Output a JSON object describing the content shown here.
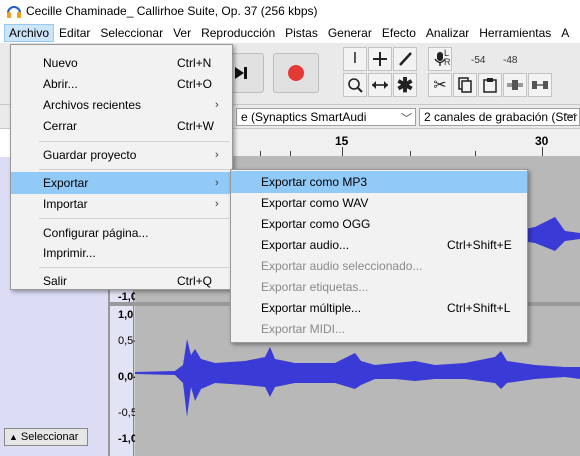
{
  "window": {
    "title": "Cecille Chaminade_ Callirhoe Suite, Op. 37 (256 kbps)"
  },
  "menubar": [
    {
      "label": "Archivo",
      "active": true
    },
    {
      "label": "Editar"
    },
    {
      "label": "Seleccionar"
    },
    {
      "label": "Ver"
    },
    {
      "label": "Reproducción"
    },
    {
      "label": "Pistas"
    },
    {
      "label": "Generar"
    },
    {
      "label": "Efecto"
    },
    {
      "label": "Analizar"
    },
    {
      "label": "Herramientas"
    },
    {
      "label": "A"
    }
  ],
  "toolbar": {
    "meter_labels": [
      "-54",
      "-48"
    ],
    "meter_channels": "L\nR"
  },
  "devices": {
    "input_device": "e (Synaptics SmartAudi",
    "channels": "2 canales de grabación (Ster"
  },
  "ruler": {
    "labels": [
      "15",
      "30"
    ]
  },
  "track": {
    "scale_top_partial": "-1,0",
    "scale": [
      "1,0",
      "0,5-",
      "0,0-",
      "-0,5-",
      "-1,0"
    ],
    "select_button": "Seleccionar"
  },
  "archivo_menu": {
    "items": [
      {
        "label": "Nuevo",
        "shortcut": "Ctrl+N"
      },
      {
        "label": "Abrir...",
        "shortcut": "Ctrl+O"
      },
      {
        "label": "Archivos recientes",
        "submenu": true
      },
      {
        "label": "Cerrar",
        "shortcut": "Ctrl+W"
      },
      {
        "label": "Guardar proyecto",
        "submenu": true
      },
      {
        "label": "Exportar",
        "submenu": true,
        "highlight": true
      },
      {
        "label": "Importar",
        "submenu": true
      },
      {
        "label": "Configurar página..."
      },
      {
        "label": "Imprimir..."
      },
      {
        "label": "Salir",
        "shortcut": "Ctrl+Q"
      }
    ]
  },
  "export_submenu": {
    "items": [
      {
        "label": "Exportar como MP3",
        "highlight": true
      },
      {
        "label": "Exportar como WAV"
      },
      {
        "label": "Exportar como OGG"
      },
      {
        "label": "Exportar audio...",
        "shortcut": "Ctrl+Shift+E"
      },
      {
        "label": "Exportar audio seleccionado...",
        "disabled": true
      },
      {
        "label": "Exportar etiquetas...",
        "disabled": true
      },
      {
        "label": "Exportar múltiple...",
        "shortcut": "Ctrl+Shift+L"
      },
      {
        "label": "Exportar MIDI...",
        "disabled": true
      }
    ]
  },
  "colors": {
    "waveform": "#3a3ad6",
    "highlight": "#91c9f7",
    "record": "#e53935"
  },
  "icons": [
    "app-headphones-icon",
    "skip-end-icon",
    "record-icon",
    "ibeam-tool-icon",
    "envelope-tool-icon",
    "draw-tool-icon",
    "zoom-tool-icon",
    "timeshift-tool-icon",
    "multi-tool-icon",
    "microphone-icon",
    "cut-icon",
    "copy-icon",
    "paste-icon",
    "trim-icon",
    "silence-icon"
  ]
}
